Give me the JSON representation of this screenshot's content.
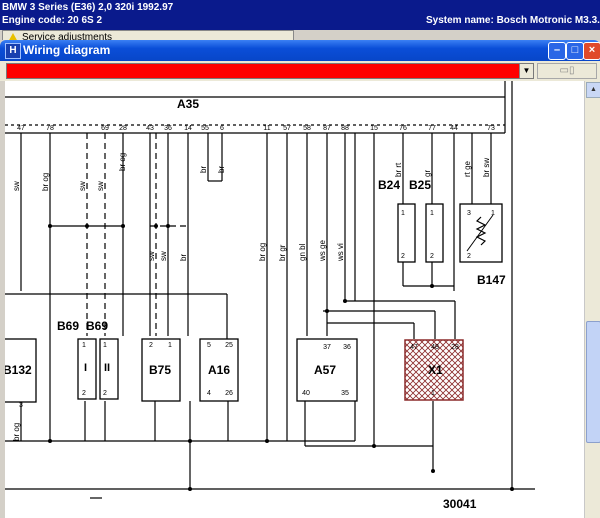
{
  "header": {
    "vehicle": "BMW   3 Series (E36) 2,0 320i 1992.97",
    "engine_code": "Engine code: 20 6S 2",
    "system_name": "System name: Bosch Motronic M3.3.1"
  },
  "background_tab": {
    "label": "Service adjustments"
  },
  "window": {
    "title": "Wiring diagram",
    "app_icon": "H"
  },
  "toolbar": {
    "selected_diagram": "",
    "button_label": "▭▯"
  },
  "diagram": {
    "sheet_number": "30041",
    "components": {
      "A35": "A35",
      "B24": "B24",
      "B25": "B25",
      "B147": "B147",
      "B69_left": "B69",
      "B69_right": "B69",
      "B75": "B75",
      "A16": "A16",
      "A57": "A57",
      "X1": "X1",
      "B132": "B132"
    },
    "top_pins": [
      {
        "id": "p47",
        "label": "47"
      },
      {
        "id": "p78",
        "label": "78"
      },
      {
        "id": "p69",
        "label": "69"
      },
      {
        "id": "p28",
        "label": "28"
      },
      {
        "id": "p43",
        "label": "43"
      },
      {
        "id": "p36",
        "label": "36"
      },
      {
        "id": "p14",
        "label": "14"
      },
      {
        "id": "p55",
        "label": "55"
      },
      {
        "id": "p6",
        "label": "6"
      },
      {
        "id": "p11",
        "label": "11"
      },
      {
        "id": "p57",
        "label": "57"
      },
      {
        "id": "p58",
        "label": "58"
      },
      {
        "id": "p87",
        "label": "87"
      },
      {
        "id": "p88",
        "label": "88"
      },
      {
        "id": "p15",
        "label": "15"
      },
      {
        "id": "p76",
        "label": "76"
      },
      {
        "id": "p77",
        "label": "77"
      },
      {
        "id": "p44",
        "label": "44"
      },
      {
        "id": "p73",
        "label": "73"
      }
    ],
    "wire_labels": [
      {
        "id": "w1",
        "label": "sw"
      },
      {
        "id": "w2",
        "label": "br og"
      },
      {
        "id": "w3",
        "label": "sw"
      },
      {
        "id": "w4",
        "label": "sw"
      },
      {
        "id": "w5",
        "label": "br og"
      },
      {
        "id": "w6",
        "label": "br"
      },
      {
        "id": "w7",
        "label": "br"
      },
      {
        "id": "w8",
        "label": "br og"
      },
      {
        "id": "w9",
        "label": "br gr"
      },
      {
        "id": "w10",
        "label": "gn bl"
      },
      {
        "id": "w11",
        "label": "ws ge"
      },
      {
        "id": "w12",
        "label": "ws vi"
      },
      {
        "id": "w13",
        "label": "br rt"
      },
      {
        "id": "w14",
        "label": "gr"
      },
      {
        "id": "w15",
        "label": "rt ge"
      },
      {
        "id": "w16",
        "label": "br sw"
      },
      {
        "id": "w17",
        "label": "sw"
      },
      {
        "id": "w18",
        "label": "sw"
      },
      {
        "id": "w19",
        "label": "br"
      },
      {
        "id": "w20",
        "label": "br og"
      }
    ],
    "component_pins": {
      "b69l_top": "1",
      "b69l_bot": "2",
      "b69r_top": "1",
      "b69r_bot": "2",
      "b75_top_l": "2",
      "b75_top_r": "1",
      "a16_top_l": "5",
      "a16_top_r": "25",
      "a16_bot_l": "4",
      "a16_bot_r": "26",
      "a57_top_l": "37",
      "a57_top_r": "36",
      "a57_bot_l": "40",
      "a57_bot_r": "35",
      "x1_p1": "47",
      "x1_p2": "48",
      "x1_p3": "28",
      "x1_bot": "1",
      "b24_top": "1",
      "b24_bot": "2",
      "b25_top": "1",
      "b25_bot": "2",
      "b147_1": "3",
      "b147_2": "1",
      "b147_3": "2",
      "b132_bot": "3"
    },
    "roman": {
      "b69l": "I",
      "b69r": "II"
    }
  }
}
